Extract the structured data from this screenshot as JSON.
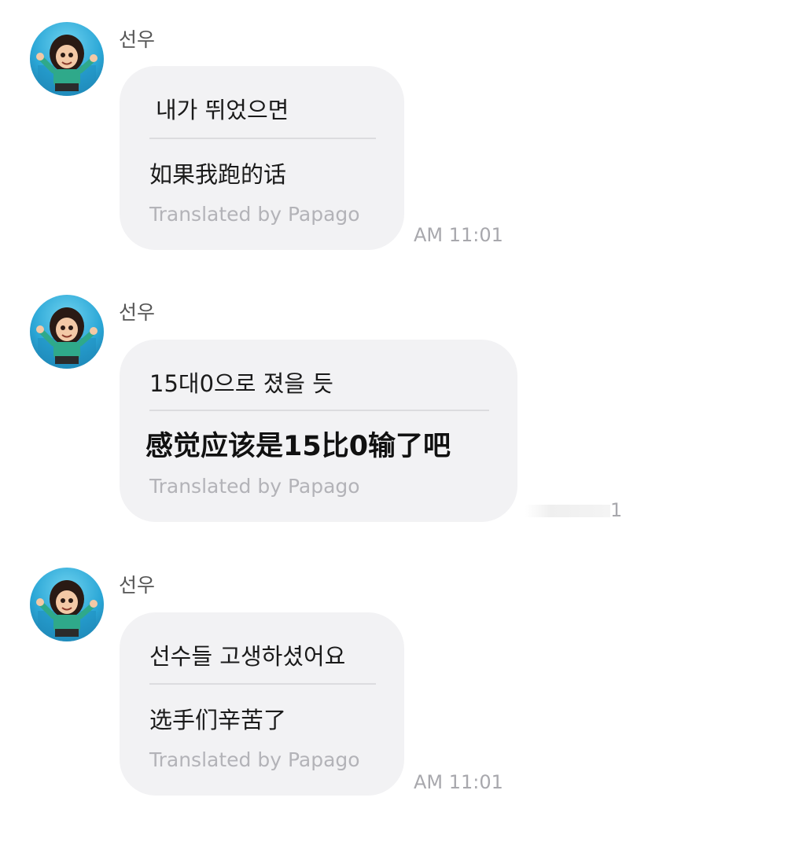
{
  "messages": [
    {
      "sender": "선우",
      "original": "내가 뛰었으면",
      "translation": "如果我跑的话",
      "translated_by": "Translated by Papago",
      "time": "AM 11:01"
    },
    {
      "sender": "선우",
      "original": "15대0으로 졌을 듯",
      "translation": "感觉应该是15比0输了吧",
      "translated_by": "Translated by Papago",
      "time_partial": "1"
    },
    {
      "sender": "선우",
      "original": "선수들 고생하셨어요",
      "translation": "选手们辛苦了",
      "translated_by": "Translated by Papago",
      "time": "AM 11:01"
    }
  ],
  "colors": {
    "bubble": "#f2f2f4",
    "text": "#1a1a1a",
    "muted": "#b3b3b8",
    "timestamp": "#a8a8ad"
  }
}
